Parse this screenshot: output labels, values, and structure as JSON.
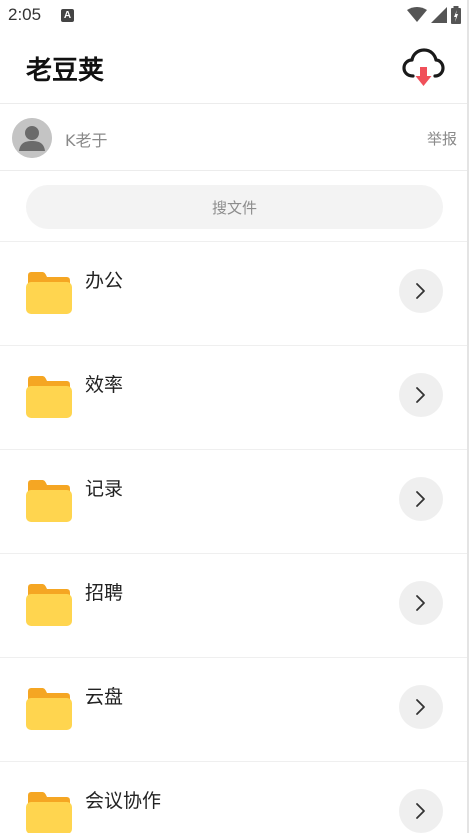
{
  "status_bar": {
    "time": "2:05",
    "notification_letter": "A",
    "icons": [
      "wifi-icon",
      "signal-icon",
      "battery-charging-icon"
    ]
  },
  "header": {
    "title": "老豆荚",
    "action_icon": "cloud-download-icon"
  },
  "user": {
    "name": "K老于",
    "report_label": "举报",
    "avatar_icon": "default-avatar-icon"
  },
  "search": {
    "placeholder": "搜文件"
  },
  "folders": [
    {
      "label": "办公"
    },
    {
      "label": "效率"
    },
    {
      "label": "记录"
    },
    {
      "label": "招聘"
    },
    {
      "label": "云盘"
    },
    {
      "label": "会议协作"
    }
  ],
  "colors": {
    "folder_back": "#F5A623",
    "folder_front": "#FFD54F",
    "download_arrow": "#F0505A",
    "chevron_bg": "#EFEFEF"
  }
}
